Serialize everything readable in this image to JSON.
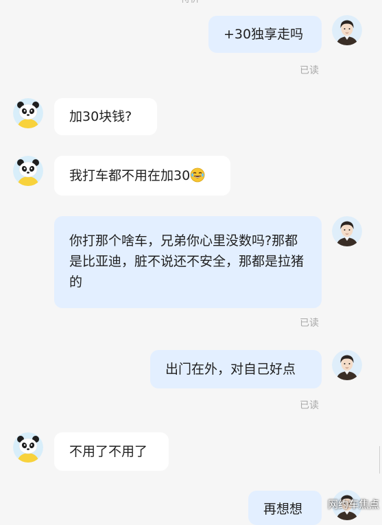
{
  "top_fragment": "特价",
  "read_label": "已读",
  "messages": [
    {
      "side": "right",
      "avatar": "young-man-avatar",
      "text": "+30独享走吗",
      "read": true
    },
    {
      "side": "left",
      "avatar": "panda-avatar",
      "text": "加30块钱?"
    },
    {
      "side": "left",
      "avatar": "panda-avatar",
      "text": "我打车都不用在加30",
      "emoji": "laughing-tears-emoji"
    },
    {
      "side": "right",
      "avatar": "young-man-avatar",
      "text": "你打那个啥车，兄弟你心里没数吗?那都是比亚迪，脏不说还不安全，那都是拉猪的",
      "read": true
    },
    {
      "side": "right",
      "avatar": "young-man-avatar",
      "text": "出门在外，对自己好点",
      "read": true
    },
    {
      "side": "left",
      "avatar": "panda-avatar",
      "text": "不用了不用了"
    },
    {
      "side": "right",
      "avatar": "young-man-avatar",
      "text": "再想想"
    }
  ],
  "watermark": "网约车焦点",
  "colors": {
    "background": "#f6f6f6",
    "bubble_left": "#ffffff",
    "bubble_right": "#e3efff",
    "read_text": "#a8a8a8"
  }
}
